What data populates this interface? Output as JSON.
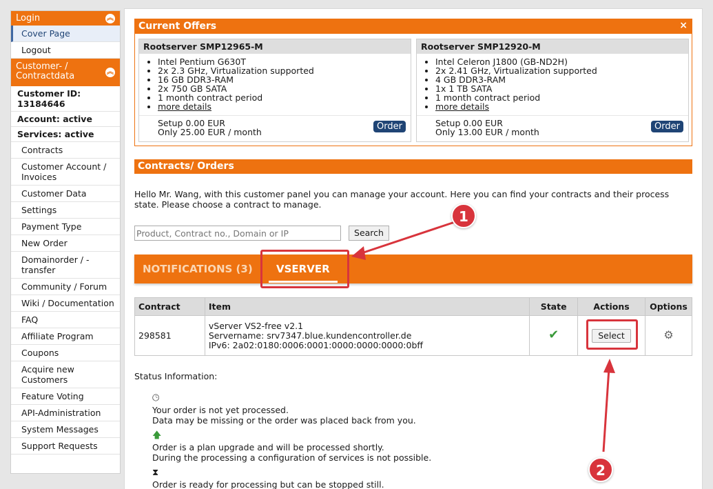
{
  "sidebar": {
    "login_header": "Login",
    "login_items": [
      {
        "label": "Cover Page",
        "active": true
      },
      {
        "label": "Logout",
        "active": false
      }
    ],
    "customer_header": "Customer- / Contractdata",
    "customer_id": "Customer ID: 13184646",
    "account_status": "Account: active",
    "services_status": "Services: active",
    "menu_items": [
      "Contracts",
      "Customer Account / Invoices",
      "Customer Data",
      "Settings",
      "Payment Type",
      "New Order",
      "Domainorder / - transfer",
      "Community / Forum",
      "Wiki / Documentation",
      "FAQ",
      "Affiliate Program",
      "Coupons",
      "Acquire new Customers",
      "Feature Voting",
      "API-Administration",
      "System Messages",
      "Support Requests"
    ]
  },
  "offers": {
    "title": "Current Offers",
    "close_icon": "×",
    "items": [
      {
        "name": "Rootserver SMP12965-M",
        "features": [
          "Intel Pentium G630T",
          "2x 2.3 GHz, Virtualization supported",
          "16 GB DDR3-RAM",
          "2x 750 GB SATA",
          "1 month contract period"
        ],
        "more": "more details",
        "setup": "Setup 0.00 EUR",
        "price": "Only 25.00 EUR / month",
        "order_label": "Order"
      },
      {
        "name": "Rootserver SMP12920-M",
        "features": [
          "Intel Celeron J1800 (GB-ND2H)",
          "2x 2.41 GHz, Virtualization supported",
          "4 GB DDR3-RAM",
          "1x 1 TB SATA",
          "1 month contract period"
        ],
        "more": "more details",
        "setup": "Setup 0.00 EUR",
        "price": "Only 13.00 EUR / month",
        "order_label": "Order"
      }
    ]
  },
  "contracts": {
    "title": "Contracts/ Orders",
    "intro": "Hello Mr. Wang, with this customer panel you can manage your account. Here you can find your contracts and their process state. Please choose a contract to manage.",
    "search_placeholder": "Product, Contract no., Domain or IP",
    "search_label": "Search",
    "tabs": [
      {
        "label": "NOTIFICATIONS (3)",
        "active": false
      },
      {
        "label": "VSERVER",
        "active": true
      }
    ],
    "table": {
      "headers": [
        "Contract",
        "Item",
        "State",
        "Actions",
        "Options"
      ],
      "rows": [
        {
          "contract": "298581",
          "item_line1": "vServer VS2-free v2.1",
          "item_line2": "Servername: srv7347.blue.kundencontroller.de",
          "item_line3": "IPv6: 2a02:0180:0006:0001:0000:0000:0000:0bff",
          "state_icon": "check-icon",
          "action_label": "Select",
          "options_icon": "gear-icon"
        }
      ]
    }
  },
  "status": {
    "title": "Status Information:",
    "entries": [
      {
        "icon": "clock-icon",
        "line1": "Your order is not yet processed.",
        "line2": "Data may be missing or the order was placed back from you."
      },
      {
        "icon": "arrow-up-icon",
        "line1": "Order is a plan upgrade and will be processed shortly.",
        "line2": "During the processing a configuration of services is not possible."
      },
      {
        "icon": "hourglass-icon",
        "line1": "Order is ready for processing but can be stopped still.",
        "line2": ""
      }
    ]
  },
  "annotations": {
    "badge1": "1",
    "badge2": "2",
    "color": "#d8343c"
  },
  "colors": {
    "accent": "#ee7210",
    "nav_dark": "#1f4475",
    "check": "#3a9a3a"
  }
}
